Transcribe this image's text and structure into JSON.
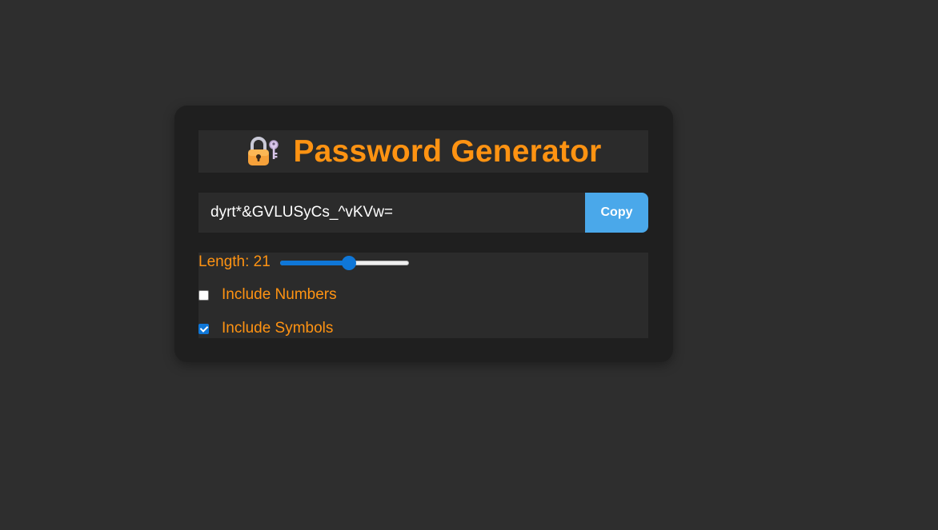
{
  "header": {
    "icon": "locked-with-key-icon",
    "title": "Password Generator"
  },
  "password": {
    "value": "dyrt*&GVLUSyCs_^vKVw=",
    "copy_label": "Copy"
  },
  "options": {
    "length_label": "Length: 21",
    "length_value": 21,
    "length_min": 8,
    "length_max": 32,
    "include_numbers": {
      "label": "Include Numbers",
      "checked": false
    },
    "include_symbols": {
      "label": "Include Symbols",
      "checked": true
    }
  },
  "colors": {
    "accent": "#ff9312",
    "button": "#4aa8ea",
    "control": "#0f77d8"
  }
}
